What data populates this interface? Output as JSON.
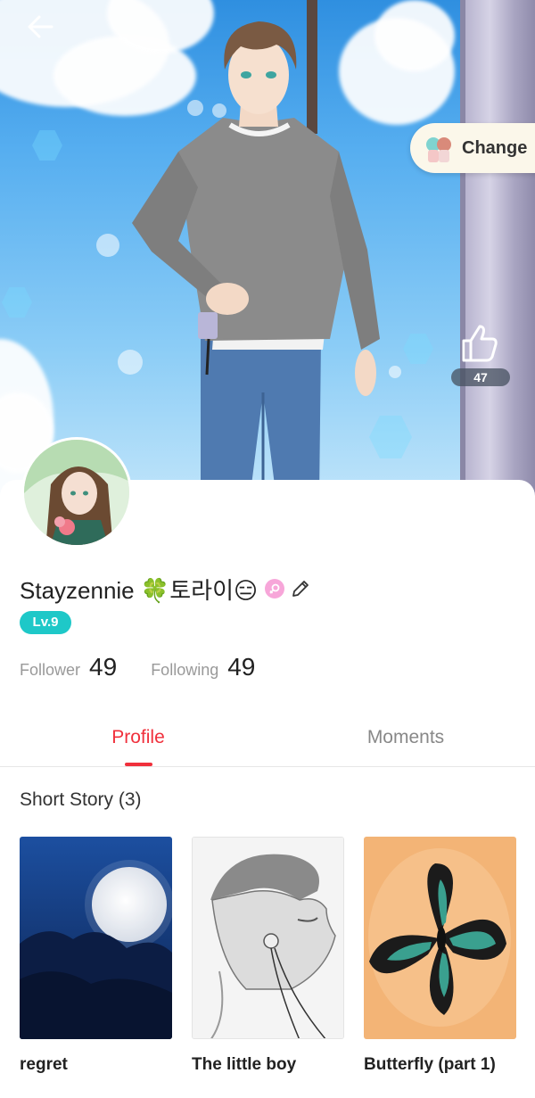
{
  "hero": {
    "change_label": "Change",
    "like_count": "47"
  },
  "profile": {
    "name": "Stayzennie 🍀토라이😑",
    "level": "Lv.9",
    "follower_label": "Follower",
    "follower_count": "49",
    "following_label": "Following",
    "following_count": "49"
  },
  "tabs": [
    {
      "label": "Profile",
      "active": true
    },
    {
      "label": "Moments",
      "active": false
    }
  ],
  "section": {
    "title": "Short Story (3)"
  },
  "stories": [
    {
      "title": "regret"
    },
    {
      "title": "The little boy"
    },
    {
      "title": "Butterfly (part 1)"
    }
  ],
  "colors": {
    "accent": "#f0303c",
    "level_badge": "#1ec8c8",
    "sky": "#56aef0"
  },
  "icons": [
    "back-arrow-icon",
    "thumbs-up-icon",
    "edit-pencil-icon",
    "female-icon"
  ]
}
